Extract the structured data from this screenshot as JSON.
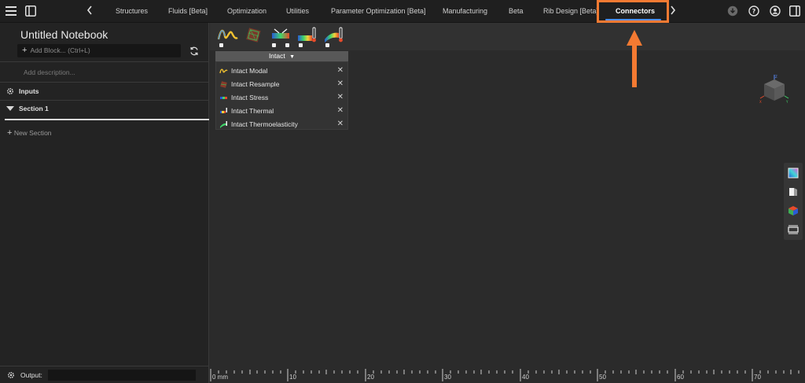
{
  "topbar": {
    "tabs": [
      {
        "label": "Structures"
      },
      {
        "label": "Fluids [Beta]"
      },
      {
        "label": "Optimization"
      },
      {
        "label": "Utilities"
      },
      {
        "label": "Parameter Optimization [Beta]"
      },
      {
        "label": "Manufacturing"
      },
      {
        "label": "Beta"
      },
      {
        "label": "Rib Design [Beta]"
      },
      {
        "label": "Connectors"
      }
    ],
    "active_tab": "Connectors"
  },
  "sidebar": {
    "title": "Untitled Notebook",
    "add_block_placeholder": "Add Block... (Ctrl+L)",
    "description_placeholder": "Add description...",
    "inputs_label": "Inputs",
    "section_label": "Section 1",
    "new_section_label": "New Section"
  },
  "output": {
    "label": "Output:"
  },
  "dropdown": {
    "header": "Intact",
    "items": [
      {
        "label": "Intact Modal",
        "icon": "modal-wave-icon"
      },
      {
        "label": "Intact Resample",
        "icon": "resample-icon"
      },
      {
        "label": "Intact Stress",
        "icon": "stress-icon"
      },
      {
        "label": "Intact Thermal",
        "icon": "thermal-icon"
      },
      {
        "label": "Intact Thermoelasticity",
        "icon": "thermoelasticity-icon"
      }
    ]
  },
  "ruler": {
    "unit": "mm",
    "labels": [
      "0 mm",
      "10",
      "20",
      "30",
      "40",
      "50",
      "60",
      "70"
    ]
  },
  "colors": {
    "accent": "#4d8fff",
    "highlight": "#f47a32",
    "background": "#2b2b2b"
  }
}
